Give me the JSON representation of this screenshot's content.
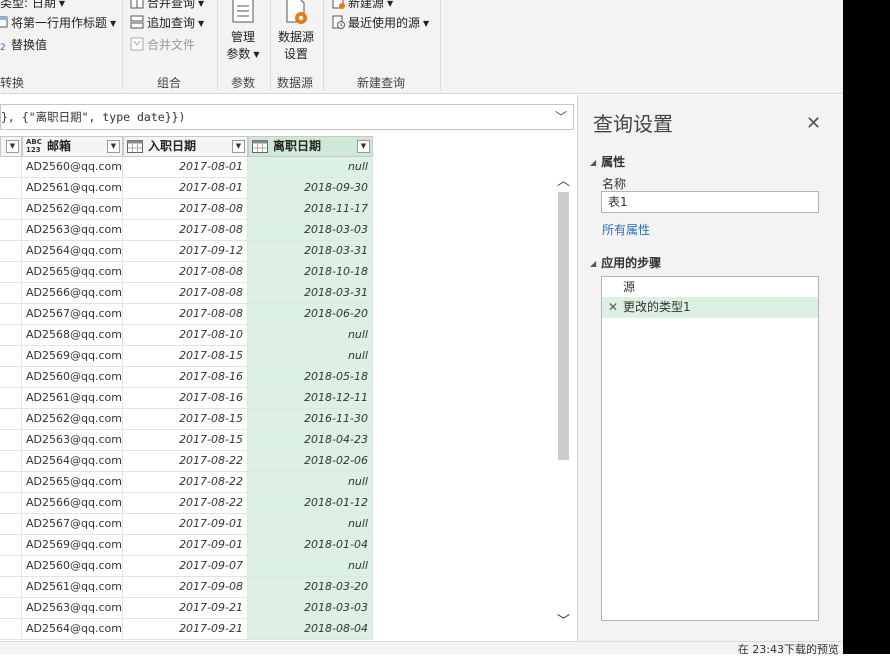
{
  "ribbon": {
    "transform_group": {
      "items": [
        "据类型: 日期",
        "将第一行用作标题",
        "替换值"
      ],
      "label": "转换"
    },
    "combine_group": {
      "items": [
        "合并查询",
        "追加查询",
        "合并文件"
      ],
      "label": "组合"
    },
    "params_group": {
      "button": [
        "管理",
        "参数"
      ],
      "label": "参数"
    },
    "datasource_group": {
      "button": [
        "数据源",
        "设置"
      ],
      "label": "数据源"
    },
    "newquery_group": {
      "items": [
        "新建源",
        "最近使用的源"
      ],
      "label": "新建查询"
    },
    "colors": {
      "accent": "#cfe9d9",
      "link": "#2a6ebb",
      "icon_orange": "#e07b1a"
    }
  },
  "formula": {
    "text": "}, {\"离职日期\", type date}})"
  },
  "grid": {
    "columns": [
      {
        "type_icon": "ABC 123",
        "label": "邮箱"
      },
      {
        "type_icon": "calendar-icon",
        "label": "入职日期"
      },
      {
        "type_icon": "calendar-icon",
        "label": "离职日期"
      }
    ],
    "rows": [
      [
        "AD2560@qq.com",
        "2017-08-01",
        "null"
      ],
      [
        "AD2561@qq.com",
        "2017-08-01",
        "2018-09-30"
      ],
      [
        "AD2562@qq.com",
        "2017-08-08",
        "2018-11-17"
      ],
      [
        "AD2563@qq.com",
        "2017-08-08",
        "2018-03-03"
      ],
      [
        "AD2564@qq.com",
        "2017-09-12",
        "2018-03-31"
      ],
      [
        "AD2565@qq.com",
        "2017-08-08",
        "2018-10-18"
      ],
      [
        "AD2566@qq.com",
        "2017-08-08",
        "2018-03-31"
      ],
      [
        "AD2567@qq.com",
        "2017-08-08",
        "2018-06-20"
      ],
      [
        "AD2568@qq.com",
        "2017-08-10",
        "null"
      ],
      [
        "AD2569@qq.com",
        "2017-08-15",
        "null"
      ],
      [
        "AD2560@qq.com",
        "2017-08-16",
        "2018-05-18"
      ],
      [
        "AD2561@qq.com",
        "2017-08-16",
        "2018-12-11"
      ],
      [
        "AD2562@qq.com",
        "2017-08-15",
        "2016-11-30"
      ],
      [
        "AD2563@qq.com",
        "2017-08-15",
        "2018-04-23"
      ],
      [
        "AD2564@qq.com",
        "2017-08-22",
        "2018-02-06"
      ],
      [
        "AD2565@qq.com",
        "2017-08-22",
        "null"
      ],
      [
        "AD2566@qq.com",
        "2017-08-22",
        "2018-01-12"
      ],
      [
        "AD2567@qq.com",
        "2017-09-01",
        "null"
      ],
      [
        "AD2569@qq.com",
        "2017-09-01",
        "2018-01-04"
      ],
      [
        "AD2560@qq.com",
        "2017-09-07",
        "null"
      ],
      [
        "AD2561@qq.com",
        "2017-09-08",
        "2018-03-20"
      ],
      [
        "AD2563@qq.com",
        "2017-09-21",
        "2018-03-03"
      ],
      [
        "AD2564@qq.com",
        "2017-09-21",
        "2018-08-04"
      ]
    ]
  },
  "query_settings": {
    "title": "查询设置",
    "properties": {
      "section": "属性",
      "name_label": "名称",
      "name_value": "表1",
      "all_properties_link": "所有属性"
    },
    "steps": {
      "section": "应用的步骤",
      "items": [
        "源",
        "更改的类型1"
      ],
      "selected": 1
    }
  },
  "status": {
    "text": "在 23:43下载的预览"
  }
}
